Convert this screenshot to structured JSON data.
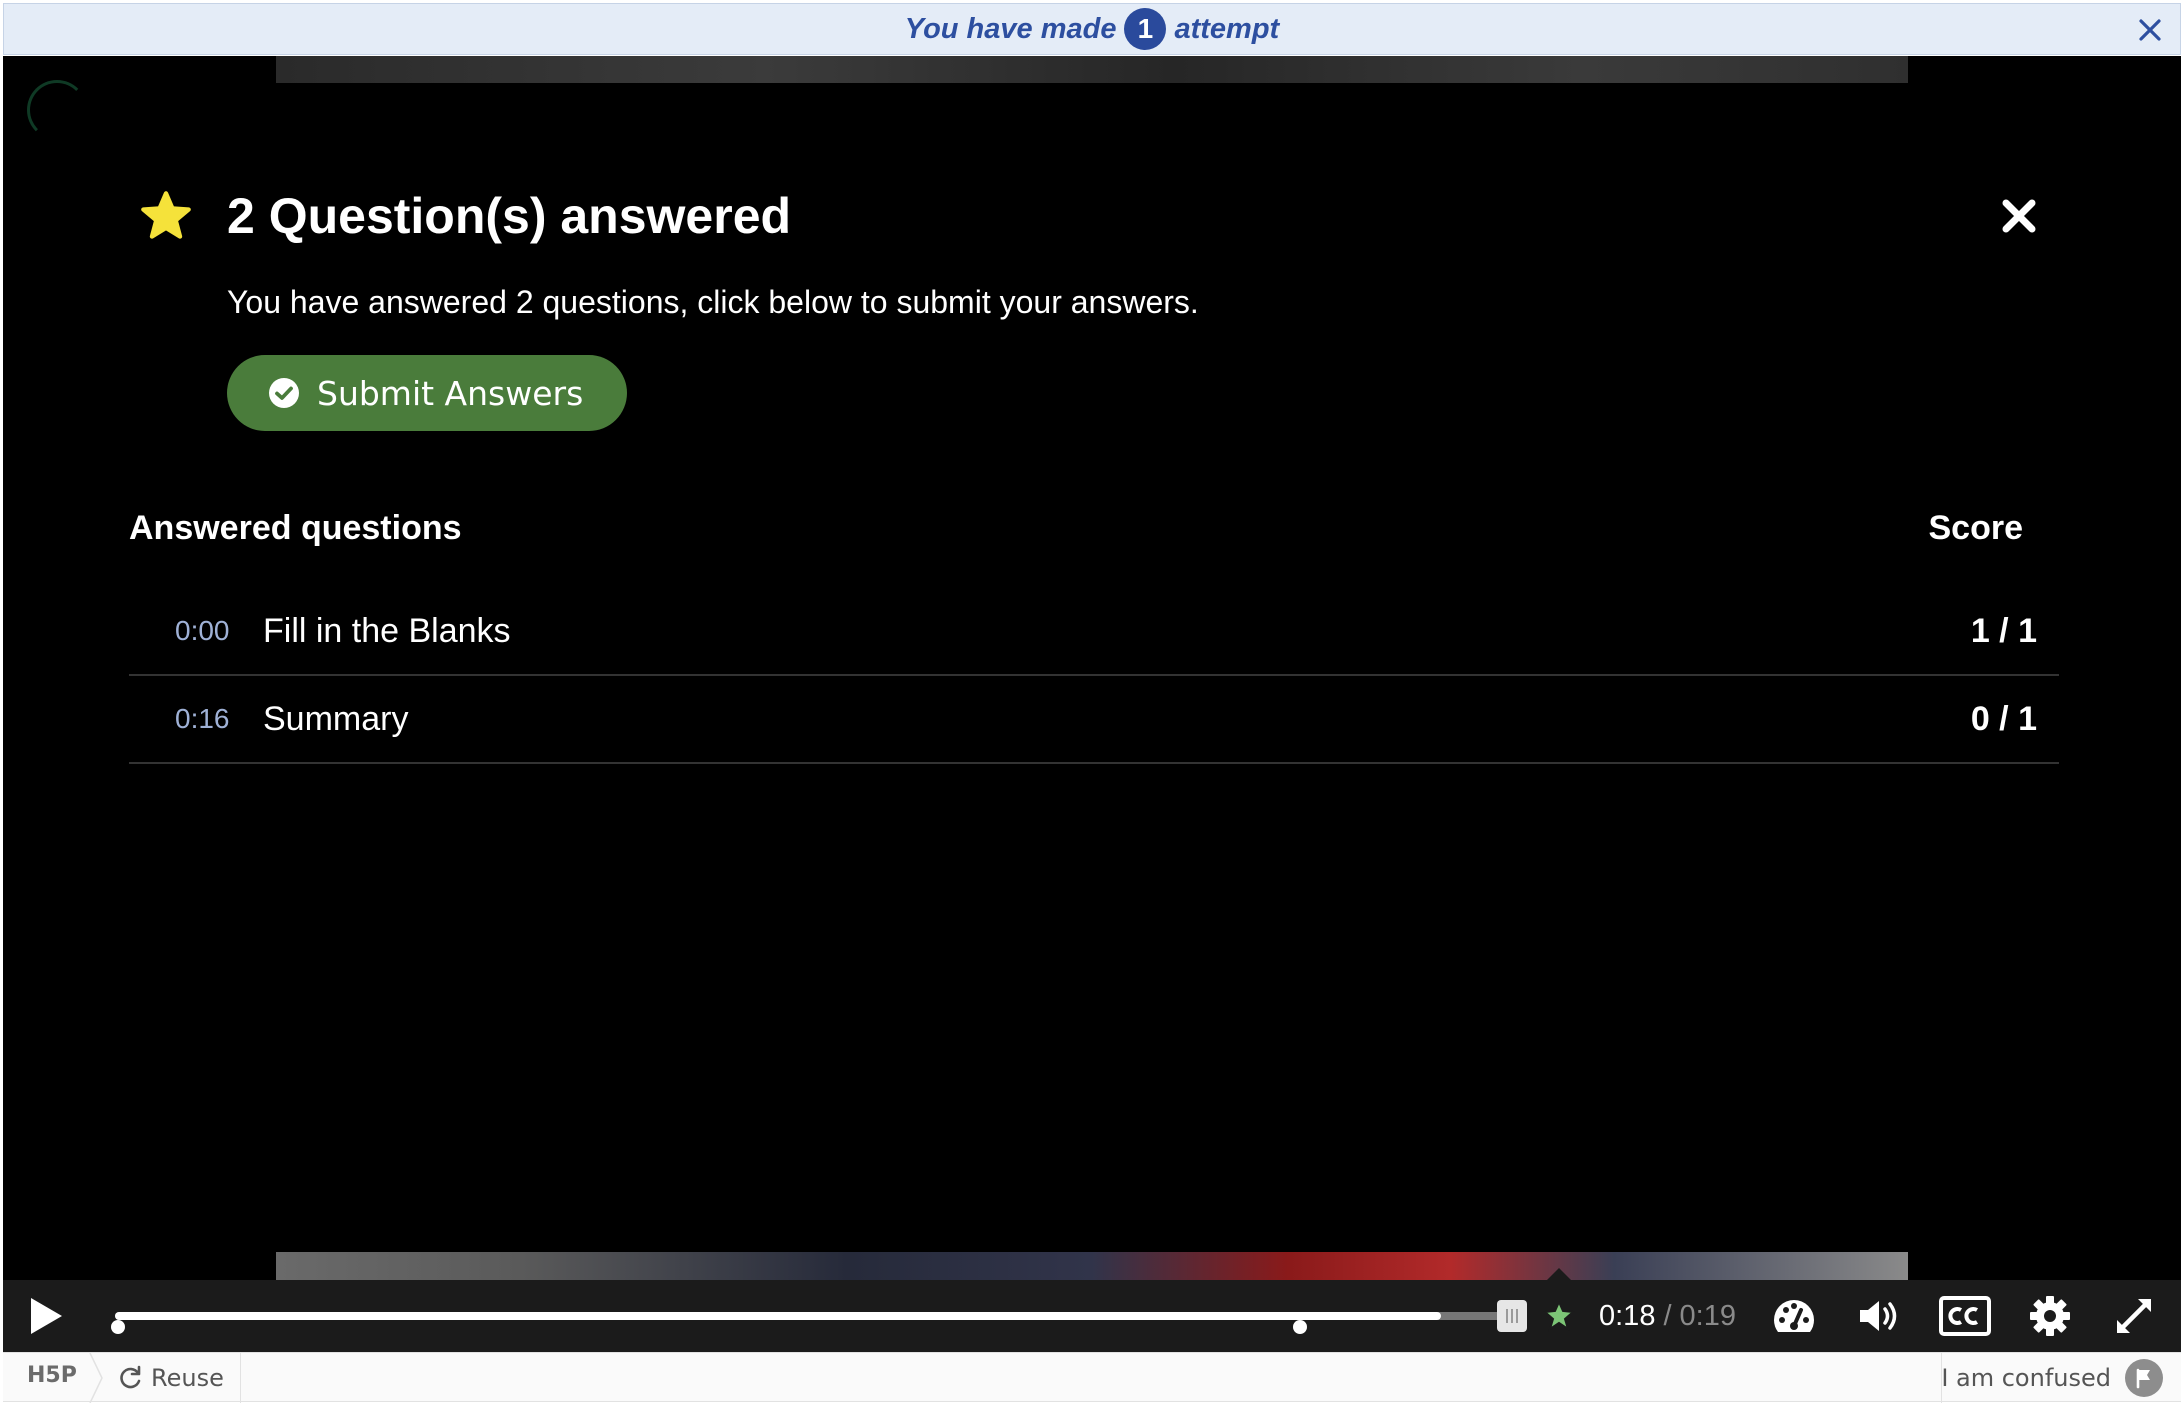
{
  "banner": {
    "text_before": "You have made",
    "attempt_count": "1",
    "text_after": "attempt"
  },
  "dialog": {
    "title": "2 Question(s) answered",
    "description": "You have answered 2 questions, click below to submit your answers.",
    "submit_label": "Submit Answers",
    "table": {
      "col_questions": "Answered questions",
      "col_score": "Score",
      "rows": [
        {
          "time": "0:00",
          "name": "Fill in the Blanks",
          "score": "1 / 1"
        },
        {
          "time": "0:16",
          "name": "Summary",
          "score": "0 / 1"
        }
      ]
    }
  },
  "player": {
    "current_time": "0:18",
    "separator": "/",
    "total_time": "0:19",
    "progress_fraction": 0.947,
    "marker_times_sec": [
      0,
      16
    ]
  },
  "footer": {
    "logo": "H5P",
    "reuse_label": "Reuse",
    "confused_label": "I am confused"
  },
  "colors": {
    "banner_bg": "#e4ecf7",
    "banner_text": "#2d4fa0",
    "submit_bg": "#4a7c3b",
    "star": "#f5e23a",
    "time_text": "#9fb1d6"
  }
}
